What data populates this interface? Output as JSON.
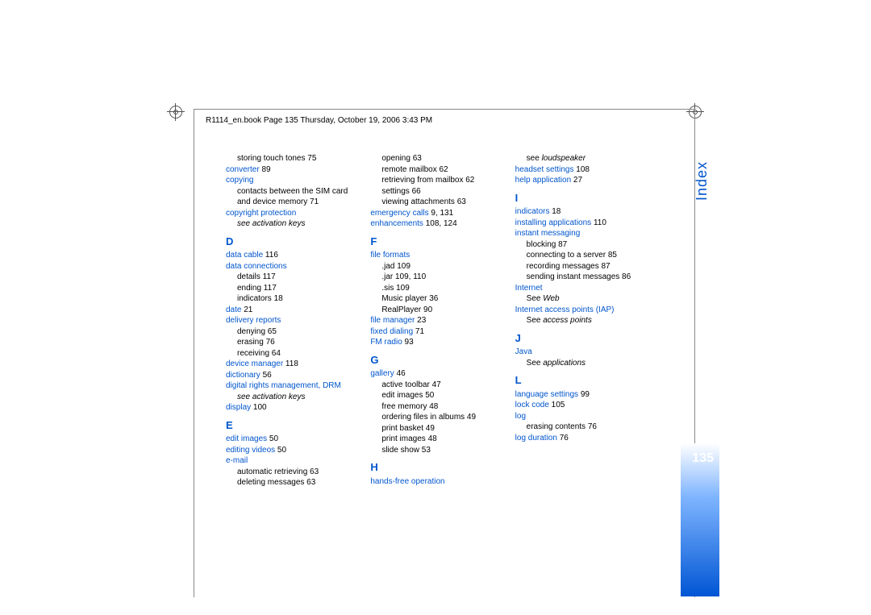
{
  "header": "R1114_en.book  Page 135  Thursday, October 19, 2006  3:43 PM",
  "section_title": "Index",
  "page_number": "135",
  "col1": {
    "storing_touch_tones": "storing touch tones  75",
    "converter": "converter",
    "converter_pg": " 89",
    "copying": "copying",
    "copying_sub": "contacts between the SIM card and device memory  71",
    "copyright_protection": "copyright protection",
    "see_activation_keys_1": "see activation keys",
    "letter_D": "D",
    "data_cable": "data cable",
    "data_cable_pg": " 116",
    "data_connections": "data connections",
    "dc_details": "details  117",
    "dc_ending": "ending  117",
    "dc_indicators": "indicators  18",
    "date": "date",
    "date_pg": " 21",
    "delivery_reports": "delivery reports",
    "dr_denying": "denying  65",
    "dr_erasing": "erasing  76",
    "dr_receiving": "receiving  64",
    "device_manager": "device manager",
    "device_manager_pg": " 118",
    "dictionary": "dictionary",
    "dictionary_pg": " 56",
    "drm": "digital rights management, DRM",
    "see_activation_keys_2": "see activation keys",
    "display": "display",
    "display_pg": " 100",
    "letter_E": "E",
    "edit_images": "edit images",
    "edit_images_pg": " 50",
    "editing_videos": "editing videos",
    "editing_videos_pg": " 50",
    "email": "e-mail"
  },
  "col2": {
    "em_auto": "automatic retrieving  63",
    "em_deleting": "deleting messages  63",
    "em_opening": "opening  63",
    "em_remote": "remote mailbox  62",
    "em_retrieving": "retrieving from mailbox  62",
    "em_settings": "settings  66",
    "em_viewing": "viewing attachments  63",
    "emergency": "emergency calls",
    "emergency_pg": " 9, 131",
    "enhancements": "enhancements",
    "enhancements_pg": " 108, 124",
    "letter_F": "F",
    "file_formats": "file formats",
    "ff_jad": ".jad  109",
    "ff_jar": ".jar  109, 110",
    "ff_sis": ".sis  109",
    "ff_music": "Music player  36",
    "ff_real": "RealPlayer  90",
    "file_manager": "file manager",
    "file_manager_pg": " 23",
    "fixed_dialing": "fixed dialing",
    "fixed_dialing_pg": " 71",
    "fm_radio": "FM radio",
    "fm_radio_pg": " 93",
    "letter_G": "G",
    "gallery": "gallery",
    "gallery_pg": " 46",
    "g_active": "active toolbar  47",
    "g_edit": "edit images  50",
    "g_free": "free memory  48",
    "g_ordering": "ordering files in albums  49",
    "g_print_basket": "print basket  49",
    "g_print_images": "print images  48"
  },
  "col3": {
    "slide_show": "slide show  53",
    "letter_H": "H",
    "hands_free": "hands-free operation",
    "see_loudspeaker": "see ",
    "loudspeaker_italic": "loudspeaker",
    "headset": "headset settings",
    "headset_pg": " 108",
    "help": "help application",
    "help_pg": " 27",
    "letter_I": "I",
    "indicators": "indicators",
    "indicators_pg": " 18",
    "installing": "installing applications",
    "installing_pg": " 110",
    "instant": "instant messaging",
    "im_blocking": "blocking  87",
    "im_connecting": "connecting to a server  85",
    "im_recording": "recording messages  87",
    "im_sending": "sending instant messages  86",
    "internet": "Internet",
    "see_web": "See ",
    "web_italic": "Web",
    "iap": "Internet access points (IAP)",
    "see_access": "See ",
    "access_italic": "access points",
    "letter_J": "J",
    "java": "Java",
    "see_apps": "See ",
    "apps_italic": "applications",
    "letter_L": "L",
    "language": "language settings",
    "language_pg": " 99",
    "lock_code": "lock code",
    "lock_code_pg": " 105",
    "log": "log",
    "log_erasing": "erasing contents  76",
    "log_duration": "log duration",
    "log_duration_pg": " 76"
  }
}
